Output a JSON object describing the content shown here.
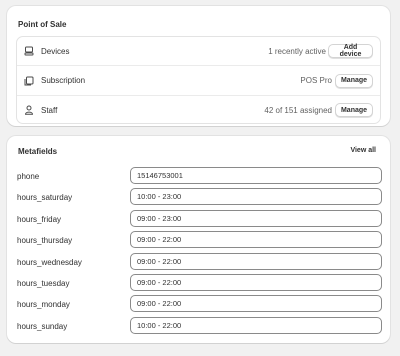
{
  "point_of_sale": {
    "title": "Point of Sale",
    "rows": [
      {
        "icon": "device-icon",
        "label": "Devices",
        "value": "1 recently active",
        "button": "Add device"
      },
      {
        "icon": "subscription-icon",
        "label": "Subscription",
        "value": "POS Pro",
        "button": "Manage"
      },
      {
        "icon": "person-icon",
        "label": "Staff",
        "value": "42 of 151 assigned",
        "button": "Manage"
      }
    ]
  },
  "metafields": {
    "title": "Metafields",
    "view_all": "View all",
    "fields": [
      {
        "label": "phone",
        "value": "15146753001"
      },
      {
        "label": "hours_saturday",
        "value": "10:00 - 23:00"
      },
      {
        "label": "hours_friday",
        "value": "09:00 - 23:00"
      },
      {
        "label": "hours_thursday",
        "value": "09:00 - 22:00"
      },
      {
        "label": "hours_wednesday",
        "value": "09:00 - 22:00"
      },
      {
        "label": "hours_tuesday",
        "value": "09:00 - 22:00"
      },
      {
        "label": "hours_monday",
        "value": "09:00 - 22:00"
      },
      {
        "label": "hours_sunday",
        "value": "10:00 - 22:00"
      }
    ]
  }
}
